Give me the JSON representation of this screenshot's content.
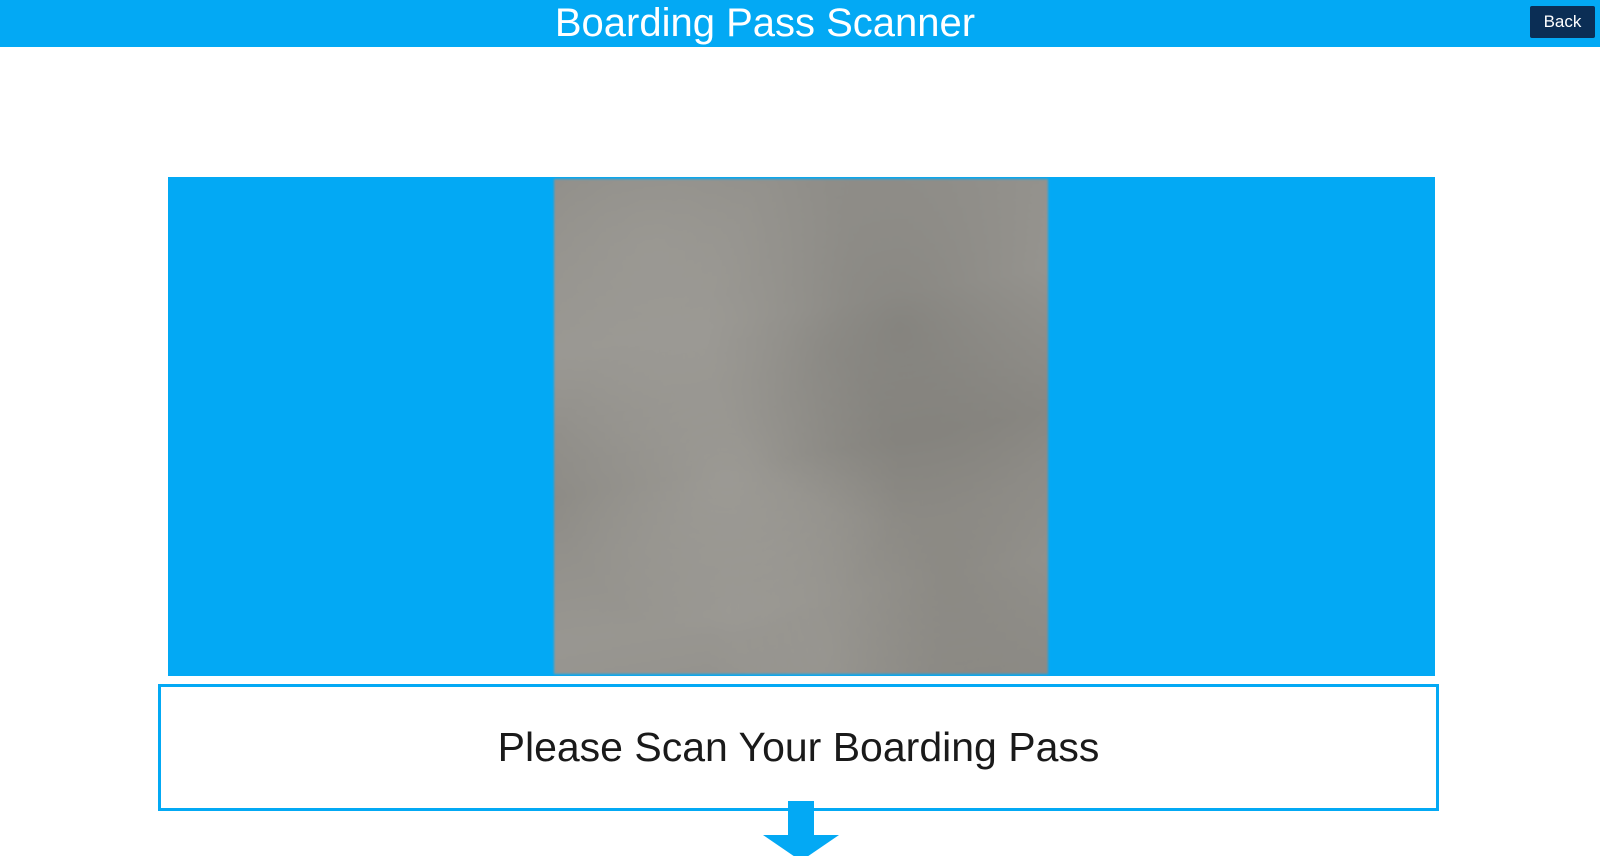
{
  "header": {
    "title": "Boarding Pass Scanner",
    "back_label": "Back"
  },
  "camera": {
    "icon": "camera-feed"
  },
  "prompt": {
    "text": "Please Scan Your Boarding Pass"
  },
  "indicator": {
    "icon": "arrow-down-icon"
  },
  "colors": {
    "accent": "#03A9F4",
    "back_button": "#0B2E55",
    "background": "#FFFFFF",
    "text": "#1A1A1A"
  }
}
